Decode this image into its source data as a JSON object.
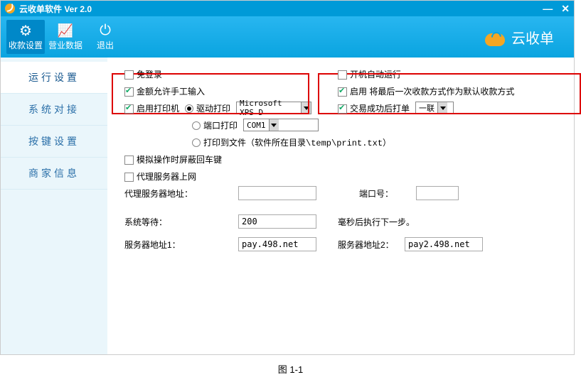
{
  "titlebar": {
    "title": "云收单软件 Ver 2.0",
    "min": "—",
    "close": "✕"
  },
  "ribbon": {
    "items": [
      {
        "label": "收款设置",
        "icon": "gear-icon",
        "active": true
      },
      {
        "label": "营业数据",
        "icon": "chart-icon",
        "active": false
      },
      {
        "label": "退出",
        "icon": "power-icon",
        "active": false
      }
    ],
    "brand": "云收单"
  },
  "sidebar": {
    "items": [
      {
        "label": "运行设置",
        "active": true
      },
      {
        "label": "系统对接",
        "active": false
      },
      {
        "label": "按键设置",
        "active": false
      },
      {
        "label": "商家信息",
        "active": false
      }
    ]
  },
  "settings": {
    "free_login": {
      "label": "免登录",
      "checked": false
    },
    "autorun": {
      "label": "开机自动运行",
      "checked": false
    },
    "manual_amount": {
      "label": "金额允许手工输入",
      "checked": true
    },
    "last_pay_default": {
      "label": "启用 将最后一次收款方式作为默认收款方式",
      "checked": true
    },
    "enable_printer": {
      "label": "启用打印机",
      "checked": true
    },
    "print_mode": {
      "driver": {
        "label": "驱动打印",
        "checked": true,
        "select_value": "Microsoft XPS D"
      },
      "port": {
        "label": "端口打印",
        "checked": false,
        "select_value": "COM1"
      },
      "file": {
        "label": "打印到文件（软件所在目录\\temp\\print.txt）",
        "checked": false
      }
    },
    "print_after_txn": {
      "label": "交易成功后打单",
      "checked": true,
      "select_value": "一联"
    },
    "sim_mask_enter": {
      "label": "模拟操作时屏蔽回车键",
      "checked": false
    },
    "proxy_enable": {
      "label": "代理服务器上网",
      "checked": false
    },
    "proxy_addr_label": "代理服务器地址：",
    "proxy_addr_value": "",
    "proxy_port_label": "端口号：",
    "proxy_port_value": "",
    "sys_wait_label": "系统等待：",
    "sys_wait_value": "200",
    "sys_wait_suffix": "毫秒后执行下一步。",
    "server1_label": "服务器地址1：",
    "server1_value": "pay.498.net",
    "server2_label": "服务器地址2：",
    "server2_value": "pay2.498.net"
  },
  "caption": "图 1-1"
}
